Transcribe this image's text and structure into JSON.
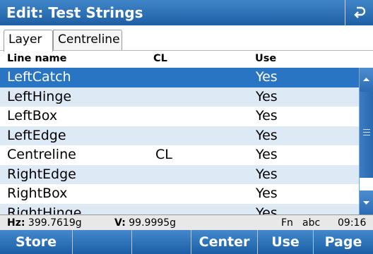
{
  "title": "Edit: Test Strings",
  "tabs": [
    {
      "label": "Layer"
    },
    {
      "label": "Centreline"
    }
  ],
  "columns": {
    "line_name": "Line name",
    "cl": "CL",
    "use": "Use"
  },
  "rows": [
    {
      "name": "LeftCatch",
      "cl": "",
      "use": "Yes",
      "selected": true
    },
    {
      "name": "LeftHinge",
      "cl": "",
      "use": "Yes"
    },
    {
      "name": "LeftBox",
      "cl": "",
      "use": "Yes"
    },
    {
      "name": "LeftEdge",
      "cl": "",
      "use": "Yes"
    },
    {
      "name": "Centreline",
      "cl": "CL",
      "use": "Yes"
    },
    {
      "name": "RightEdge",
      "cl": "",
      "use": "Yes"
    },
    {
      "name": "RightBox",
      "cl": "",
      "use": "Yes"
    },
    {
      "name": "RightHinge",
      "cl": "",
      "use": "Yes"
    }
  ],
  "status": {
    "hz_label": "Hz:",
    "hz_value": "399.7619g",
    "v_label": "V:",
    "v_value": "99.9995g",
    "fn": "Fn",
    "input_mode": "abc",
    "time": "09:16"
  },
  "softkeys": [
    "Store",
    "",
    "",
    "Center",
    "Use",
    "Page"
  ],
  "colors": {
    "accent": "#2a74c4",
    "row_alt": "#dde9f5"
  }
}
